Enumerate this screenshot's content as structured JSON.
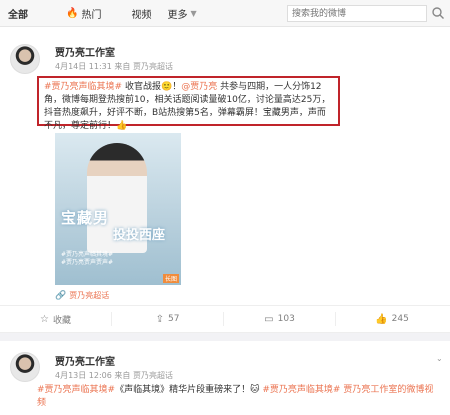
{
  "tabs": [
    {
      "label": "全部",
      "active": true
    },
    {
      "label": "热门",
      "icon": "fire-icon"
    },
    {
      "label": "视频"
    },
    {
      "label": "更多"
    }
  ],
  "search": {
    "placeholder": "搜索我的微博"
  },
  "post1": {
    "author": "贾乃亮工作室",
    "meta": "4月14日 11:31 来自 贾乃亮超话",
    "content": {
      "tag": "#贾乃亮声临其境#",
      "t1": " 收官战报",
      "t2": "！",
      "at": "@贾乃亮",
      "t3": " 共参与四期，一人分饰12角，微博每期登热搜前10，相关话题阅读量破10亿，讨论量高达25万，抖音热度飙升，好评不断，B站热搜第5名，弹幕霸屏！宝藏男声，声而不凡，尊定前行！"
    },
    "poster": {
      "title": "宝藏男",
      "sub": "投投西座",
      "small": "#贾乃亮声临其境#\n#贾乃亮贾声贾声#",
      "gif": "长图"
    },
    "source": "贾乃亮超话",
    "actions": [
      {
        "label": "收藏",
        "icon": "star-icon"
      },
      {
        "label": "57",
        "icon": "share-icon"
      },
      {
        "label": "103",
        "icon": "comment-icon"
      },
      {
        "label": "245",
        "icon": "like-icon"
      }
    ]
  },
  "post2": {
    "author": "贾乃亮工作室",
    "meta": "4月13日 12:06 来自 贾乃亮超话",
    "tag1": "#贾乃亮声临其境#",
    "t1": "《声临其境》精华片段重磅来了！",
    "tag2": "#贾乃亮声临其境#",
    "t2": " 贾乃亮工作室的微博视频"
  }
}
